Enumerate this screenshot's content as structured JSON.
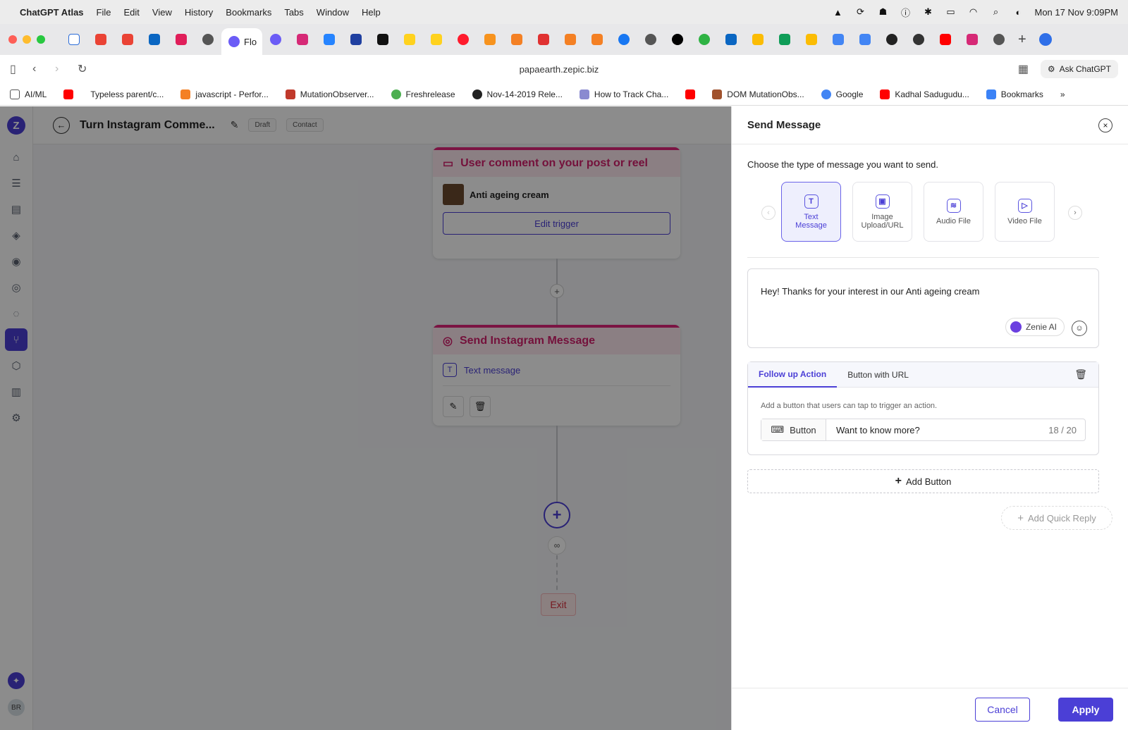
{
  "menubar": {
    "app_name": "ChatGPT Atlas",
    "items": [
      "File",
      "Edit",
      "View",
      "History",
      "Bookmarks",
      "Tabs",
      "Window",
      "Help"
    ],
    "clock": "Mon 17 Nov  9:09PM"
  },
  "browser": {
    "active_tab_label": "Flo",
    "url": "papaearth.zepic.biz",
    "ask_label": "Ask ChatGPT",
    "bookmarks": [
      {
        "label": "AI/ML",
        "color": "#888888"
      },
      {
        "label": "",
        "color": "#ff0000"
      },
      {
        "label": "Typeless parent/c...",
        "color": "#ffffff"
      },
      {
        "label": "javascript - Perfor...",
        "color": "#f48024"
      },
      {
        "label": "MutationObserver...",
        "color": "#c0392b"
      },
      {
        "label": "Freshrelease",
        "color": "#4caf50"
      },
      {
        "label": "Nov-14-2019 Rele...",
        "color": "#222222"
      },
      {
        "label": "How to Track Cha...",
        "color": "#8a8ad0"
      },
      {
        "label": "",
        "color": "#ff0000"
      },
      {
        "label": "DOM MutationObs...",
        "color": "#a0522d"
      },
      {
        "label": "Google",
        "color": "#4285f4"
      },
      {
        "label": "Kadhal Sadugudu...",
        "color": "#ff0000"
      },
      {
        "label": "Bookmarks",
        "color": "#3b82f6"
      }
    ],
    "overflow": "»"
  },
  "flow": {
    "title": "Turn Instagram Comme...",
    "draft_badge": "Draft",
    "contact_badge": "Contact",
    "trigger_node": {
      "title": "User comment on your post or reel",
      "post": "Anti ageing cream",
      "edit_label": "Edit trigger"
    },
    "message_node": {
      "title": "Send Instagram Message",
      "item": "Text message"
    },
    "exit_label": "Exit"
  },
  "sidebar": {
    "logo": "Z",
    "avatar": "BR"
  },
  "panel": {
    "title": "Send Message",
    "prompt": "Choose the type of message you want to send.",
    "types": [
      {
        "label": "Text Message",
        "icon": "T"
      },
      {
        "label": "Image Upload/URL",
        "icon": "▣"
      },
      {
        "label": "Audio File",
        "icon": "≋"
      },
      {
        "label": "Video File",
        "icon": "▷"
      }
    ],
    "message_text": "Hey! Thanks for your interest in our Anti ageing cream",
    "zenie_label": "Zenie AI",
    "follow_tabs": [
      "Follow up Action",
      "Button with URL"
    ],
    "follow_hint": "Add a button that users can tap to trigger an action.",
    "button_label": "Button",
    "button_value": "Want to know more?",
    "char_count": "18 / 20",
    "add_button": "Add Button",
    "add_quick_reply": "Add Quick Reply",
    "cancel": "Cancel",
    "apply": "Apply"
  },
  "colors": {
    "brand": "#4b3fd6",
    "instagram_pink": "#e0267a"
  }
}
